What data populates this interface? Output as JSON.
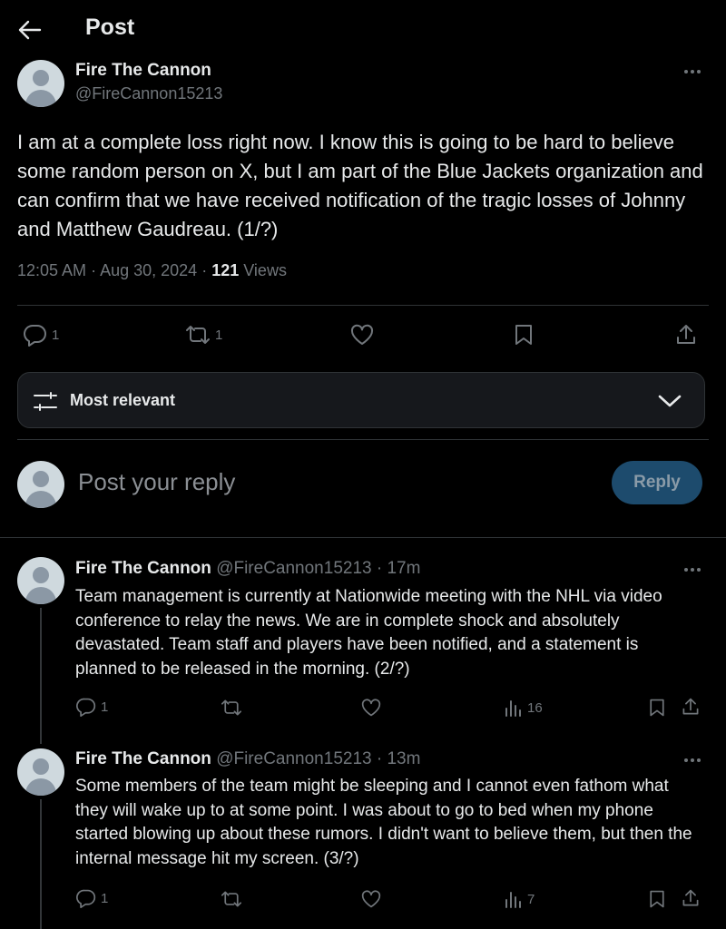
{
  "header": {
    "title": "Post"
  },
  "post": {
    "author_name": "Fire The Cannon",
    "handle": "@FireCannon15213",
    "text": "I am at a complete loss right now. I know this is going to be hard to believe some random person on X, but I am part of the Blue Jackets organization and can confirm that we have received notification of the tragic losses of Johnny and Matthew Gaudreau. (1/?)",
    "time": "12:05 AM",
    "date": "Aug 30, 2024",
    "views_count": "121",
    "views_label": "Views",
    "reply_count": "1",
    "repost_count": "1"
  },
  "sort": {
    "label": "Most relevant"
  },
  "composer": {
    "placeholder": "Post your reply",
    "button": "Reply"
  },
  "replies": [
    {
      "author_name": "Fire The Cannon",
      "handle": "@FireCannon15213",
      "age": "17m",
      "text": "Team management is currently at Nationwide meeting with the NHL via video conference to relay the news. We are in complete shock and absolutely devastated. Team staff and players have been notified, and a statement is planned to be released in the morning. (2/?)",
      "reply_count": "1",
      "views": "16"
    },
    {
      "author_name": "Fire The Cannon",
      "handle": "@FireCannon15213",
      "age": "13m",
      "text": "Some members of the team might be sleeping and I cannot even fathom what they will wake up to at some point. I was about to go to bed when my phone started blowing up about these rumors. I didn't want to believe them, but then the internal message hit my screen. (3/?)",
      "reply_count": "1",
      "views": "7"
    }
  ],
  "colors": {
    "background": "#000000",
    "text": "#e7e9ea",
    "muted": "#71767b",
    "border": "#2f3336",
    "accent_button": "#1d4b6d"
  }
}
